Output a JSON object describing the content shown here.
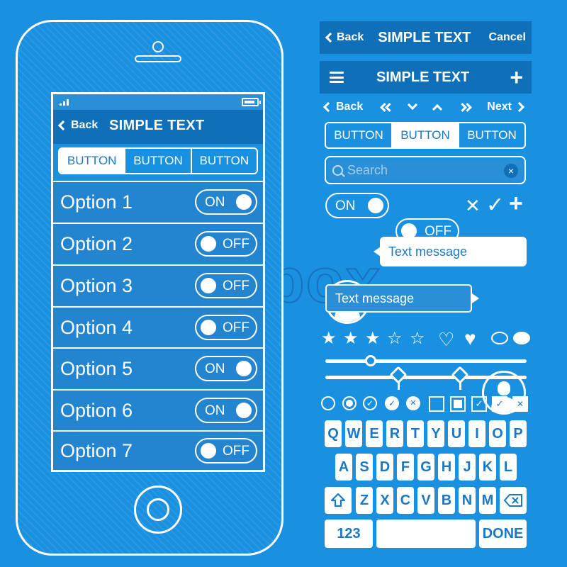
{
  "phone": {
    "nav": {
      "back": "Back",
      "title": "SIMPLE TEXT"
    },
    "segments": [
      "BUTTON",
      "BUTTON",
      "BUTTON"
    ],
    "options": [
      {
        "label": "Option 1",
        "state": "ON"
      },
      {
        "label": "Option 2",
        "state": "OFF"
      },
      {
        "label": "Option 3",
        "state": "OFF"
      },
      {
        "label": "Option 4",
        "state": "OFF"
      },
      {
        "label": "Option 5",
        "state": "ON"
      },
      {
        "label": "Option 6",
        "state": "ON"
      },
      {
        "label": "Option 7",
        "state": "OFF"
      }
    ]
  },
  "kit": {
    "navbar1": {
      "back": "Back",
      "title": "SIMPLE TEXT",
      "cancel": "Cancel"
    },
    "navbar2": {
      "title": "SIMPLE TEXT",
      "plus": "+"
    },
    "pager": {
      "back": "Back",
      "next": "Next"
    },
    "segments": [
      "BUTTON",
      "BUTTON",
      "BUTTON"
    ],
    "search": {
      "placeholder": "Search",
      "clear": "×"
    },
    "toggles": {
      "on": "ON",
      "off": "OFF"
    },
    "glyphs": {
      "cross": "✕",
      "check": "✓",
      "plus": "+"
    },
    "chat": {
      "incoming": "Text message",
      "outgoing": "Text message"
    },
    "stars": {
      "filled": "★",
      "empty": "☆",
      "heart_outline": "♡",
      "heart_filled": "♥"
    },
    "keyboard": {
      "row1": [
        "Q",
        "W",
        "E",
        "R",
        "T",
        "Y",
        "U",
        "I",
        "O",
        "P"
      ],
      "row2": [
        "A",
        "S",
        "D",
        "F",
        "G",
        "H",
        "J",
        "K",
        "L"
      ],
      "row3": [
        "Z",
        "X",
        "C",
        "V",
        "B",
        "N",
        "M"
      ],
      "numbers": "123",
      "done": "DONE"
    }
  },
  "watermark": "colourbox"
}
